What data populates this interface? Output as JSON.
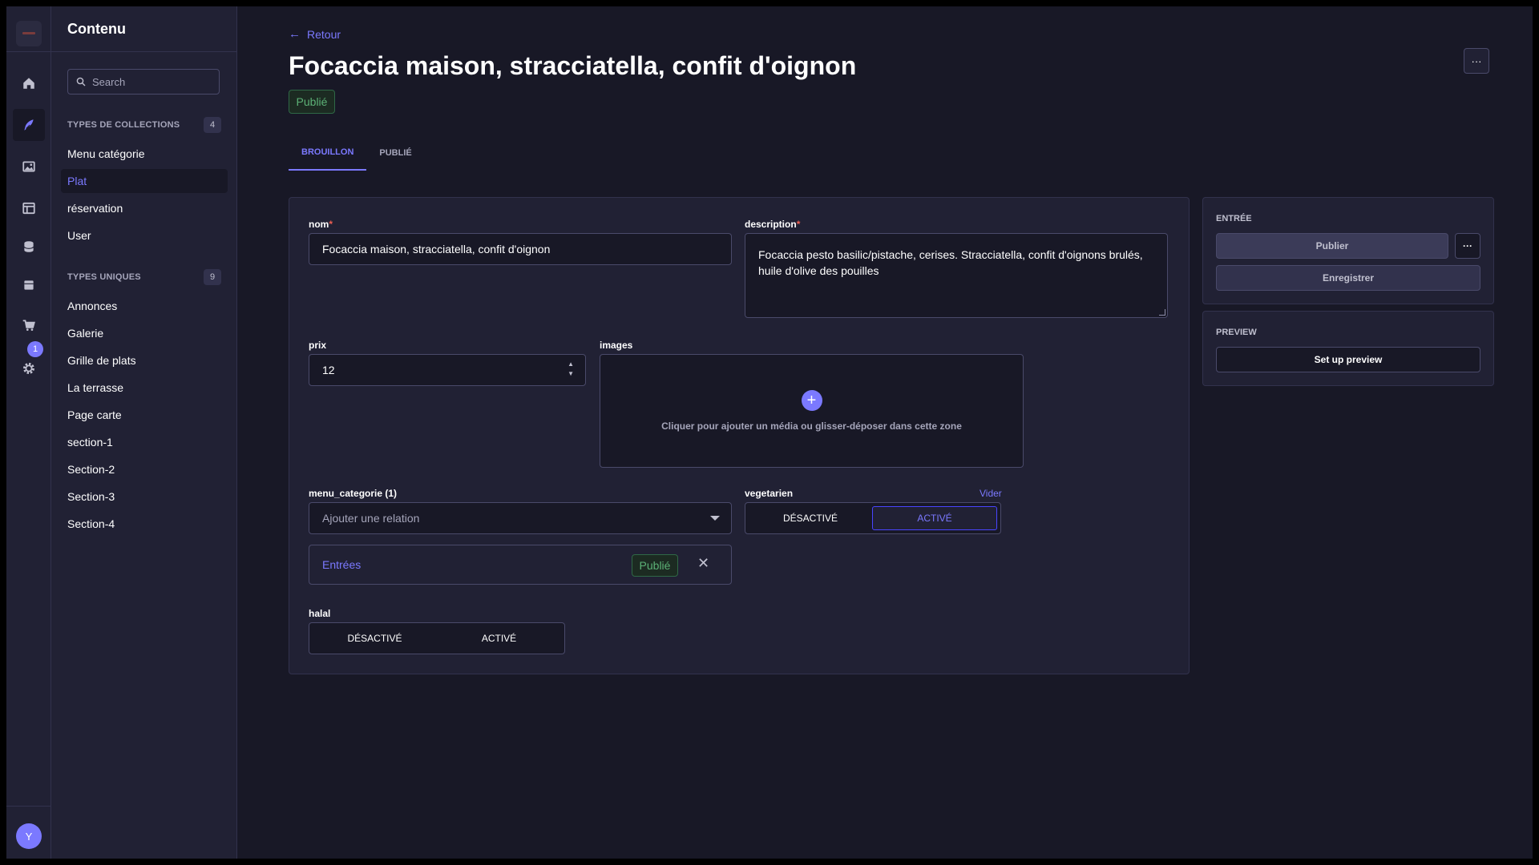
{
  "app": {
    "section_title": "Contenu",
    "user_initial": "Y",
    "notification_count": "1"
  },
  "rail": {
    "items": [
      {
        "icon": "home-icon"
      },
      {
        "icon": "content-manager-icon"
      },
      {
        "icon": "media-library-icon"
      },
      {
        "icon": "layout-icon"
      },
      {
        "icon": "database-icon"
      },
      {
        "icon": "archive-icon"
      },
      {
        "icon": "shopping-cart-icon"
      },
      {
        "icon": "settings-icon"
      }
    ]
  },
  "sidebar": {
    "search_placeholder": "Search",
    "collections": {
      "label": "TYPES DE COLLECTIONS",
      "count": "4",
      "items": [
        {
          "label": "Menu catégorie"
        },
        {
          "label": "Plat"
        },
        {
          "label": "réservation"
        },
        {
          "label": "User"
        }
      ]
    },
    "singles": {
      "label": "TYPES UNIQUES",
      "count": "9",
      "items": [
        {
          "label": "Annonces"
        },
        {
          "label": "Galerie"
        },
        {
          "label": "Grille de plats"
        },
        {
          "label": "La terrasse"
        },
        {
          "label": "Page carte"
        },
        {
          "label": "section-1"
        },
        {
          "label": "Section-2"
        },
        {
          "label": "Section-3"
        },
        {
          "label": "Section-4"
        }
      ]
    }
  },
  "header": {
    "back_label": "Retour",
    "title": "Focaccia maison, stracciatella, confit d'oignon",
    "status": "Publié",
    "more_label": "···"
  },
  "tabs": [
    {
      "label": "BROUILLON"
    },
    {
      "label": "PUBLIÉ"
    }
  ],
  "form": {
    "nom": {
      "label": "nom",
      "value": "Focaccia maison, stracciatella, confit d'oignon"
    },
    "description": {
      "label": "description",
      "value": "Focaccia pesto basilic/pistache, cerises. Stracciatella, confit d'oignons brulés, huile d'olive des pouilles"
    },
    "prix": {
      "label": "prix",
      "value": "12"
    },
    "images": {
      "label": "images",
      "hint": "Cliquer pour ajouter un média ou glisser-déposer dans cette zone"
    },
    "menu_categorie": {
      "label": "menu_categorie (1)",
      "placeholder": "Ajouter une relation",
      "relation": {
        "label": "Entrées",
        "status": "Publié"
      }
    },
    "vegetarien": {
      "label": "vegetarien",
      "clear_label": "Vider",
      "off_label": "DÉSACTIVÉ",
      "on_label": "ACTIVÉ",
      "value": "ACTIVÉ"
    },
    "halal": {
      "label": "halal",
      "off_label": "DÉSACTIVÉ",
      "on_label": "ACTIVÉ"
    }
  },
  "entry_panel": {
    "heading": "ENTRÉE",
    "publish_label": "Publier",
    "more_label": "···",
    "save_label": "Enregistrer"
  },
  "preview_panel": {
    "heading": "PREVIEW",
    "button_label": "Set up preview"
  },
  "colors": {
    "accent": "#7b79ff",
    "success": "#5cb176",
    "background": "#181826",
    "surface": "#212134"
  }
}
